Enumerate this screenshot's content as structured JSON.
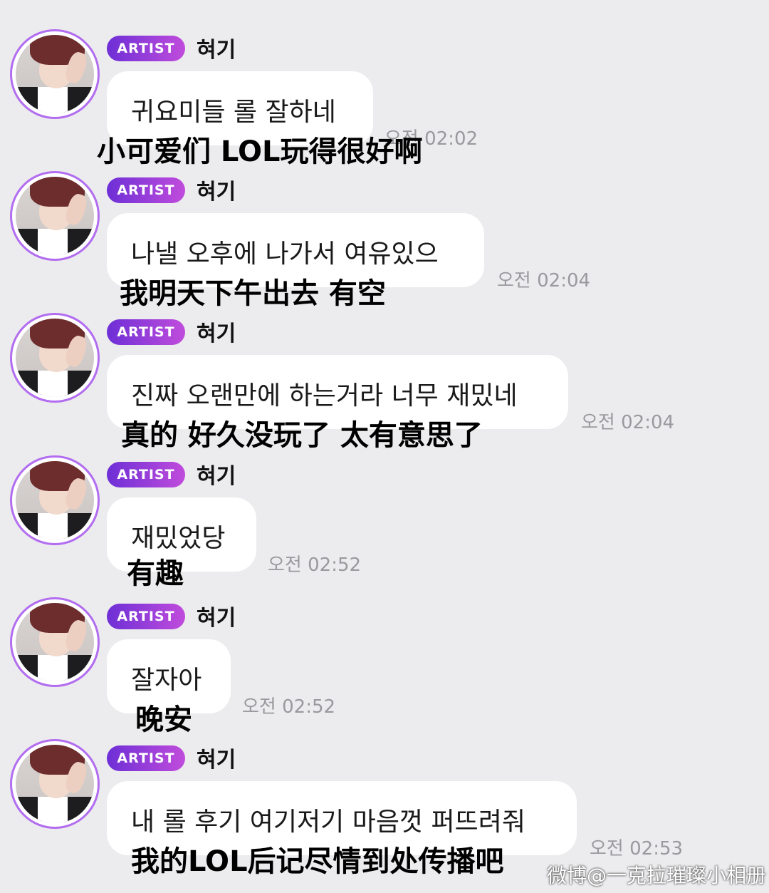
{
  "messages": [
    {
      "badge": "ARTIST",
      "name": "혀기",
      "korean": "귀요미들 롤 잘하네",
      "chinese": "小可爱们 LOL玩得很好啊",
      "time": "오전 02:02"
    },
    {
      "badge": "ARTIST",
      "name": "혀기",
      "korean": "나낼 오후에 나가서 여유있으",
      "chinese": "我明天下午出去 有空",
      "time": "오전 02:04"
    },
    {
      "badge": "ARTIST",
      "name": "혀기",
      "korean": "진짜 오랜만에 하는거라 너무 재밌네",
      "chinese": "真的 好久没玩了 太有意思了",
      "time": "오전 02:04"
    },
    {
      "badge": "ARTIST",
      "name": "혀기",
      "korean": "재밌었당",
      "chinese": "有趣",
      "time": "오전 02:52"
    },
    {
      "badge": "ARTIST",
      "name": "혀기",
      "korean": "잘자아",
      "chinese": "晚安",
      "time": "오전 02:52"
    },
    {
      "badge": "ARTIST",
      "name": "혀기",
      "korean": "내 롤 후기 여기저기 마음껏 퍼뜨려줘",
      "chinese": "我的LOL后记尽情到处传播吧",
      "time": "오전 02:53"
    }
  ],
  "watermark": "微博@一克拉璀璨小相册"
}
